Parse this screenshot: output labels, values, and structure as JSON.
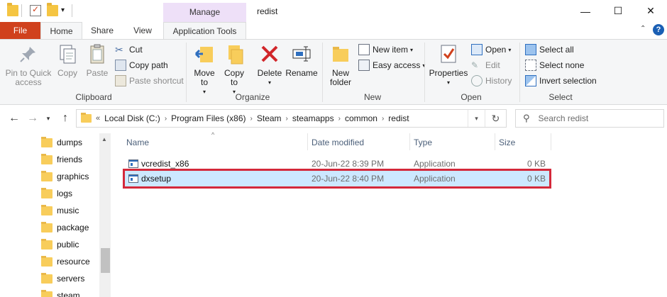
{
  "window": {
    "title": "redist",
    "context_tab": "Manage",
    "controls": {
      "minimize": "—",
      "maximize": "☐",
      "close": "✕"
    },
    "qat_dropdown": "▾"
  },
  "tabs": {
    "file": "File",
    "home": "Home",
    "share": "Share",
    "view": "View",
    "app_tools": "Application Tools",
    "help": "?",
    "collapse": "⌃"
  },
  "ribbon": {
    "clipboard": {
      "label": "Clipboard",
      "pin": "Pin to Quick access",
      "copy": "Copy",
      "paste": "Paste",
      "cut": "Cut",
      "copy_path": "Copy path",
      "paste_shortcut": "Paste shortcut"
    },
    "organize": {
      "label": "Organize",
      "move_to": "Move to",
      "copy_to": "Copy to",
      "delete": "Delete",
      "rename": "Rename"
    },
    "new": {
      "label": "New",
      "new_folder": "New folder",
      "new_item": "New item",
      "easy_access": "Easy access"
    },
    "open": {
      "label": "Open",
      "properties": "Properties",
      "open": "Open",
      "edit": "Edit",
      "history": "History"
    },
    "select": {
      "label": "Select",
      "select_all": "Select all",
      "select_none": "Select none",
      "invert": "Invert selection"
    }
  },
  "address": {
    "overflow": "«",
    "crumbs": [
      "Local Disk (C:)",
      "Program Files (x86)",
      "Steam",
      "steamapps",
      "common",
      "redist"
    ],
    "refresh": "↻",
    "search_placeholder": "Search redist"
  },
  "nav_pane": [
    "dumps",
    "friends",
    "graphics",
    "logs",
    "music",
    "package",
    "public",
    "resource",
    "servers",
    "steam"
  ],
  "columns": {
    "name": "Name",
    "date": "Date modified",
    "type": "Type",
    "size": "Size"
  },
  "files": [
    {
      "name": "vcredist_x86",
      "date": "20-Jun-22 8:39 PM",
      "type": "Application",
      "size": "0 KB"
    },
    {
      "name": "dxsetup",
      "date": "20-Jun-22 8:40 PM",
      "type": "Application",
      "size": "0 KB"
    }
  ],
  "colors": {
    "file_tab": "#d0411d",
    "selection": "#cce8ff",
    "highlight_border": "#d4293b",
    "manage_tab": "#eee0f8"
  }
}
